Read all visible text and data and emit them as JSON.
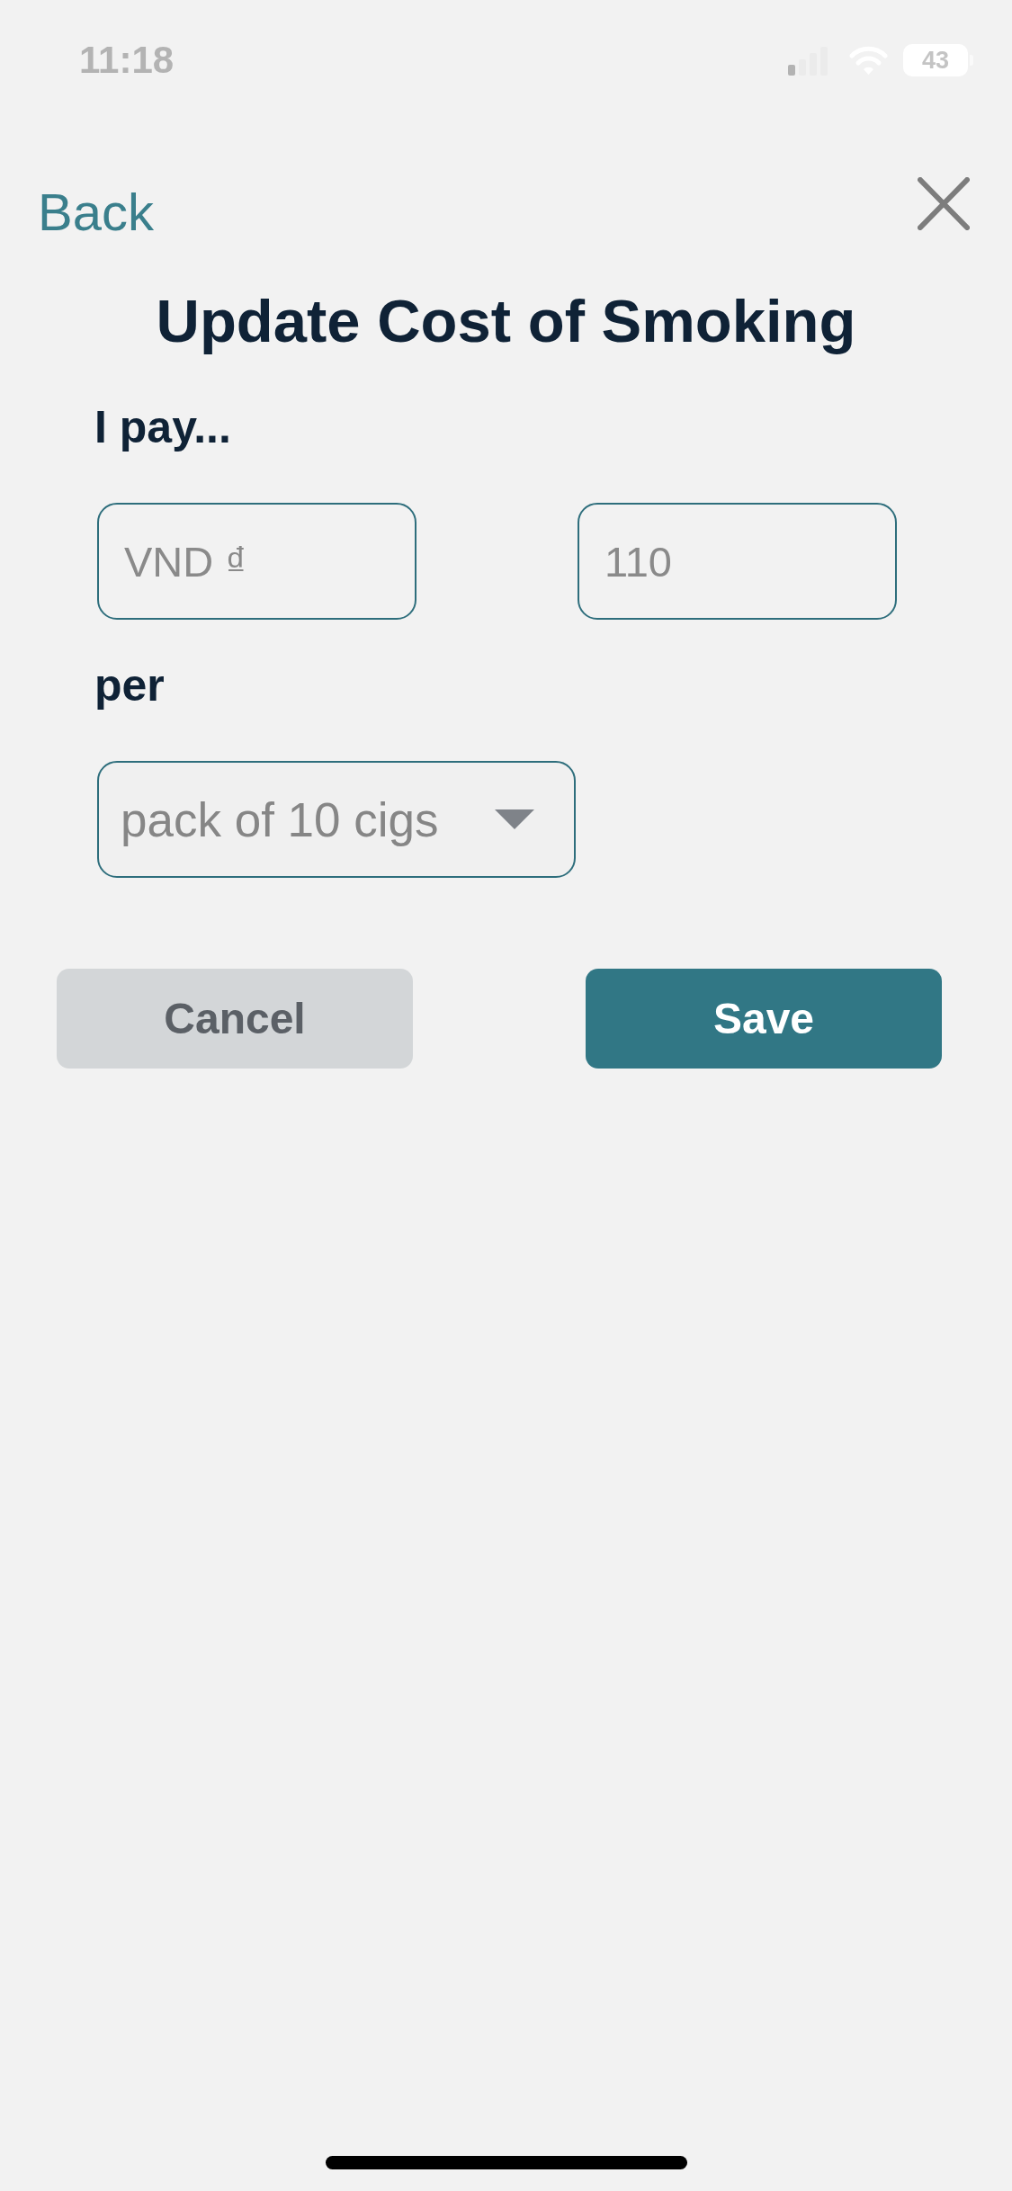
{
  "status_bar": {
    "time": "11:18",
    "battery": "43"
  },
  "header": {
    "back_label": "Back",
    "title": "Update Cost of Smoking"
  },
  "form": {
    "price_label": "I pay...",
    "currency_field": {
      "placeholder": "VND ₫"
    },
    "amount_field": {
      "placeholder": "110"
    },
    "unit_label": "per",
    "unit_select": {
      "value": "pack of 10 cigs"
    }
  },
  "buttons": [
    {
      "label": "Cancel",
      "kind": "cancel"
    },
    {
      "label": "Save",
      "kind": "save"
    }
  ]
}
